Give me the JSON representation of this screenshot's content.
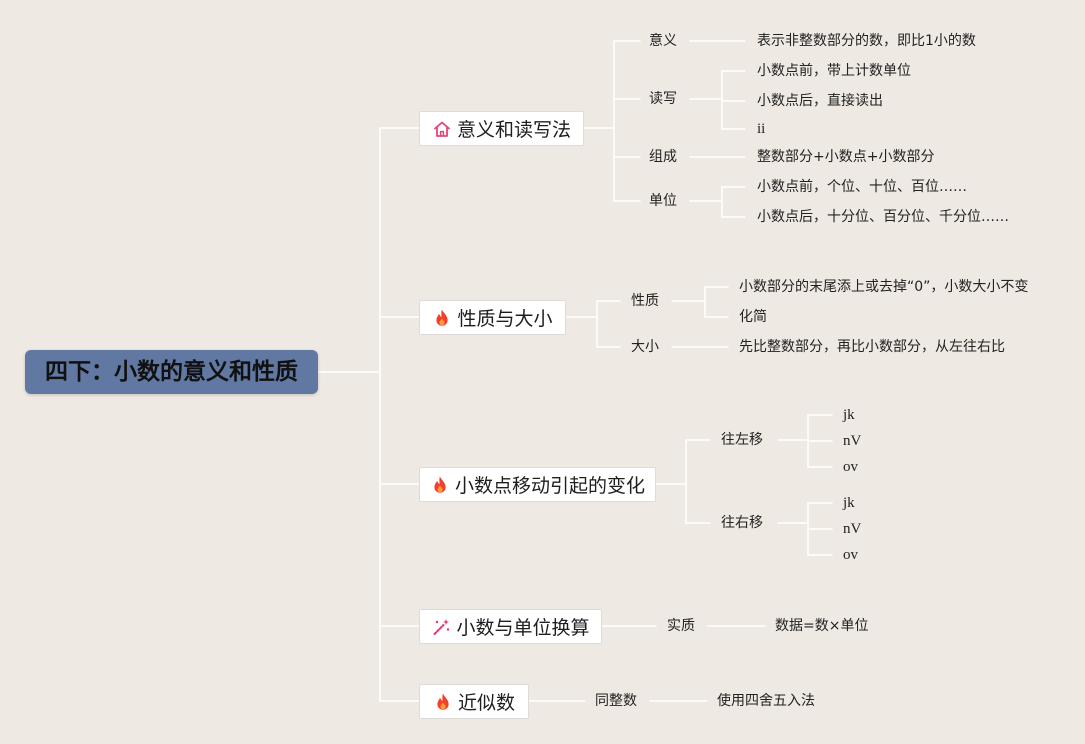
{
  "colors": {
    "background_color": "#efe9e4",
    "root_bg": "#6179a2",
    "root_text": "#111111",
    "node_bg": "#ffffff",
    "node_border": "#e0dbd6",
    "line": "#ffffff",
    "text": "#222222",
    "house_icon": "#e0457b",
    "fire_icon": "#f2402a",
    "wand_icon": "#e8336d"
  },
  "root": {
    "title": "四下：小数的意义和性质"
  },
  "branches": [
    {
      "label": "意义和读写法",
      "icon": "house-icon",
      "topics": [
        {
          "label": "意义",
          "details": [
            "表示非整数部分的数，即比1小的数"
          ]
        },
        {
          "label": "读写",
          "details": [
            "小数点前，带上计数单位",
            "小数点后，直接读出",
            "ii"
          ]
        },
        {
          "label": "组成",
          "details": [
            "整数部分+小数点+小数部分"
          ]
        },
        {
          "label": "单位",
          "details": [
            "小数点前，个位、十位、百位……",
            "小数点后，十分位、百分位、千分位……"
          ]
        }
      ]
    },
    {
      "label": "性质与大小",
      "icon": "fire-icon",
      "topics": [
        {
          "label": "性质",
          "details": [
            "小数部分的末尾添上或去掉“0”，小数大小不变",
            "化简"
          ]
        },
        {
          "label": "大小",
          "details": [
            "先比整数部分，再比小数部分，从左往右比"
          ]
        }
      ]
    },
    {
      "label": "小数点移动引起的变化",
      "icon": "fire-icon",
      "topics": [
        {
          "label": "往左移",
          "details": [
            "jk",
            "nV",
            "ov"
          ]
        },
        {
          "label": "往右移",
          "details": [
            "jk",
            "nV",
            "ov"
          ]
        }
      ]
    },
    {
      "label": "小数与单位换算",
      "icon": "wand-icon",
      "topics": [
        {
          "label": "实质",
          "details": [
            "数据=数×单位"
          ]
        }
      ]
    },
    {
      "label": "近似数",
      "icon": "fire-icon",
      "topics": [
        {
          "label": "同整数",
          "details": [
            "使用四舍五入法"
          ]
        }
      ]
    }
  ]
}
